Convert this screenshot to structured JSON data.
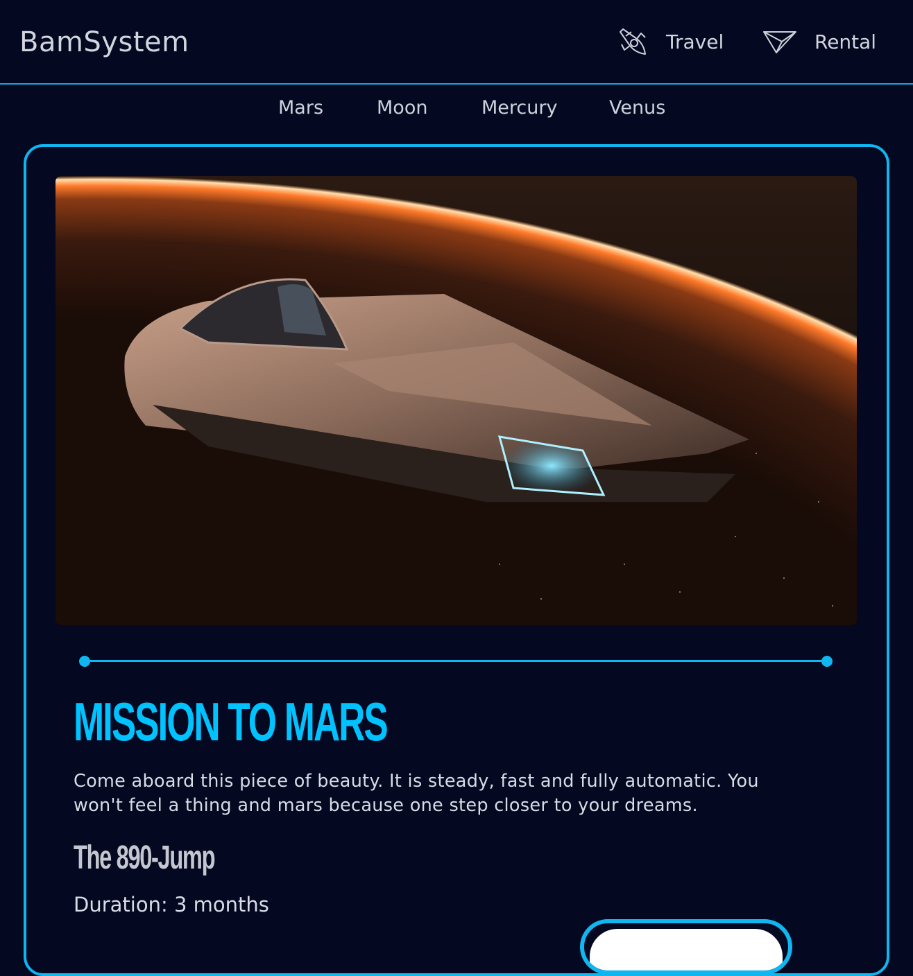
{
  "brand": "BamSystem",
  "top_nav": {
    "travel": {
      "label": "Travel",
      "icon": "rocket-icon"
    },
    "rental": {
      "label": "Rental",
      "icon": "paper-plane-icon"
    }
  },
  "destinations": [
    "Mars",
    "Moon",
    "Mercury",
    "Venus"
  ],
  "mission": {
    "title": "MISSION TO MARS",
    "description": "Come aboard this piece of beauty. It is steady, fast and fully automatic. You won't feel a thing and mars because one step closer to your dreams.",
    "ship_name": "The 890-Jump",
    "duration": "Duration: 3 months"
  },
  "colors": {
    "background": "#040820",
    "accent": "#0fb6ef",
    "title": "#00c2ff",
    "text": "#d9dce6"
  }
}
